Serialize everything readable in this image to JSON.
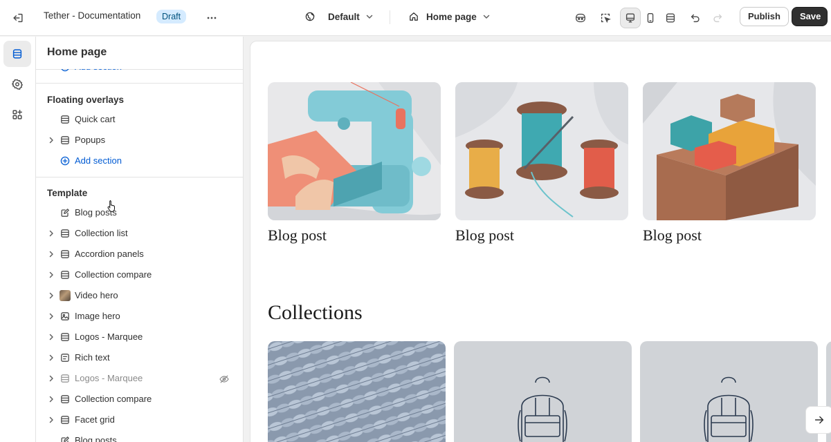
{
  "topbar": {
    "title": "Tether - Documentation",
    "badge": "Draft",
    "theme_selector": "Default",
    "page_selector": "Home page",
    "publish_label": "Publish",
    "save_label": "Save",
    "icons": [
      "exit-icon",
      "more-icon",
      "globe-icon",
      "home-icon",
      "ai-icon",
      "inspect-icon",
      "desktop-icon",
      "mobile-icon",
      "fullwidth-icon",
      "undo-icon",
      "redo-icon"
    ]
  },
  "rail": {
    "items": [
      {
        "name": "sections",
        "icon": "layout-sections-icon",
        "active": true
      },
      {
        "name": "settings",
        "icon": "gear-icon",
        "active": false
      },
      {
        "name": "apps",
        "icon": "apps-icon",
        "active": false
      }
    ]
  },
  "sidebar": {
    "title": "Home page",
    "top_add_section": "Add section",
    "floating": {
      "heading": "Floating overlays",
      "items": [
        {
          "label": "Quick cart",
          "icon": "section-icon",
          "expandable": false
        },
        {
          "label": "Popups",
          "icon": "section-icon",
          "expandable": true
        }
      ],
      "add_label": "Add section"
    },
    "template": {
      "heading": "Template",
      "items": [
        {
          "label": "Blog posts",
          "icon": "edit-icon",
          "expandable": false
        },
        {
          "label": "Collection list",
          "icon": "section-icon",
          "expandable": true
        },
        {
          "label": "Accordion panels",
          "icon": "section-icon",
          "expandable": true
        },
        {
          "label": "Collection compare",
          "icon": "section-icon",
          "expandable": true
        },
        {
          "label": "Video hero",
          "icon": "video-thumbnail",
          "expandable": true
        },
        {
          "label": "Image hero",
          "icon": "image-icon",
          "expandable": true
        },
        {
          "label": "Logos - Marquee",
          "icon": "section-icon",
          "expandable": true
        },
        {
          "label": "Rich text",
          "icon": "text-icon",
          "expandable": true
        },
        {
          "label": "Logos - Marquee",
          "icon": "section-icon",
          "expandable": true,
          "hidden": true
        },
        {
          "label": "Collection compare",
          "icon": "section-icon",
          "expandable": true
        },
        {
          "label": "Facet grid",
          "icon": "section-icon",
          "expandable": true
        },
        {
          "label": "Blog posts",
          "icon": "edit-icon",
          "expandable": false
        }
      ]
    }
  },
  "preview": {
    "posts": [
      {
        "title": "Blog post",
        "image": "sewing-machine-illustration"
      },
      {
        "title": "Blog post",
        "image": "thread-spools-illustration"
      },
      {
        "title": "Blog post",
        "image": "shipping-boxes-illustration"
      }
    ],
    "collections_title": "Collections",
    "collections": [
      {
        "image": "knitted-blanket-photo"
      },
      {
        "image": "backpack-placeholder"
      },
      {
        "image": "backpack-placeholder"
      }
    ],
    "next_icon": "arrow-right-icon"
  },
  "colors": {
    "accent": "#005bd3",
    "badge_bg": "#d5ebff",
    "badge_text": "#00527c",
    "save_bg": "#303030"
  }
}
